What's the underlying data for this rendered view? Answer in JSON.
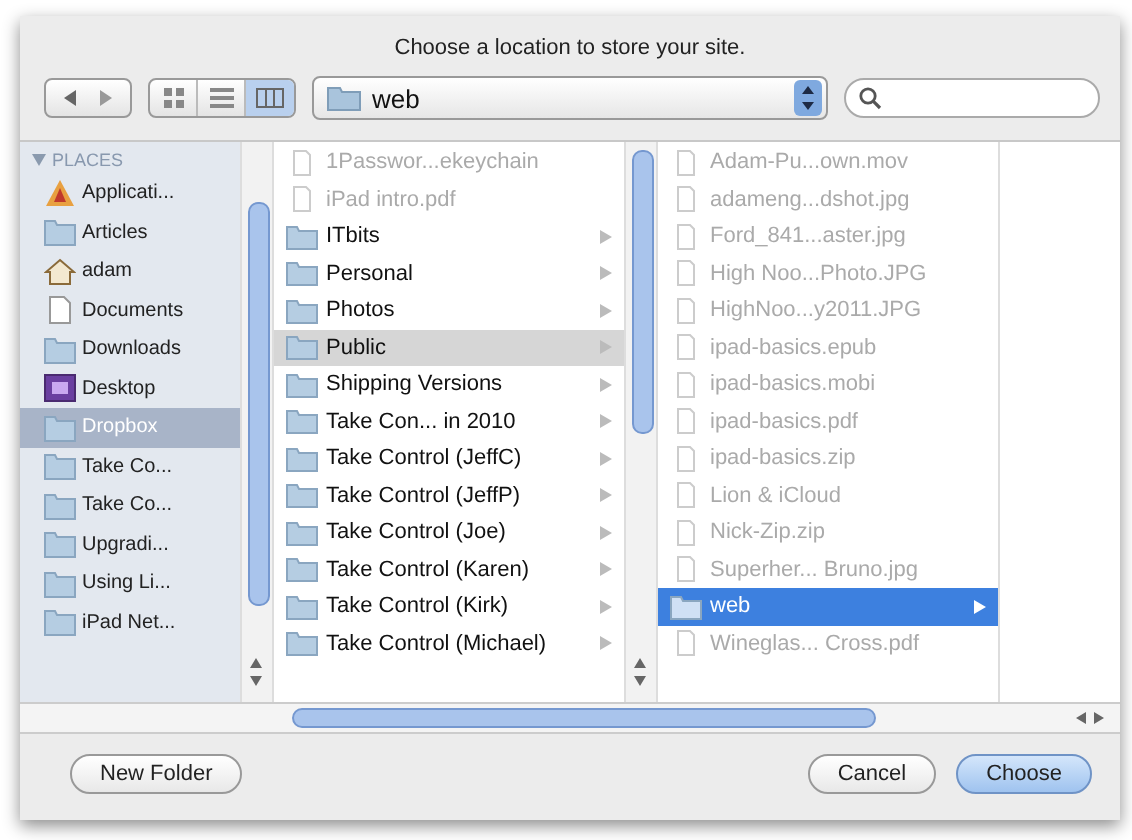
{
  "message": "Choose a location to store your site.",
  "toolbar": {
    "view_modes": [
      {
        "kind": "icon",
        "selected": false
      },
      {
        "kind": "list",
        "selected": false
      },
      {
        "kind": "column",
        "selected": true
      }
    ],
    "location": "web"
  },
  "sidebar": {
    "heading": "PLACES",
    "expanded": true,
    "items": [
      {
        "label": "Applicati...",
        "kind": "app",
        "selected": false
      },
      {
        "label": "Articles",
        "kind": "folder",
        "selected": false
      },
      {
        "label": "adam",
        "kind": "home",
        "selected": false
      },
      {
        "label": "Documents",
        "kind": "document",
        "selected": false
      },
      {
        "label": "Downloads",
        "kind": "folder",
        "selected": false
      },
      {
        "label": "Desktop",
        "kind": "desktop",
        "selected": false
      },
      {
        "label": "Dropbox",
        "kind": "folder",
        "selected": true
      },
      {
        "label": "Take Co...",
        "kind": "folder",
        "selected": false
      },
      {
        "label": "Take Co...",
        "kind": "folder",
        "selected": false
      },
      {
        "label": "Upgradi...",
        "kind": "folder",
        "selected": false
      },
      {
        "label": "Using Li...",
        "kind": "folder",
        "selected": false
      },
      {
        "label": "iPad Net...",
        "kind": "folder",
        "selected": false
      }
    ]
  },
  "columns": [
    {
      "focused": false,
      "items": [
        {
          "name": "1Passwor...ekeychain",
          "kind": "file",
          "disabled": true,
          "selected": false
        },
        {
          "name": "iPad intro.pdf",
          "kind": "file",
          "disabled": true,
          "selected": false
        },
        {
          "name": "ITbits",
          "kind": "folder",
          "disabled": false,
          "selected": false
        },
        {
          "name": "Personal",
          "kind": "folder",
          "disabled": false,
          "selected": false
        },
        {
          "name": "Photos",
          "kind": "folder",
          "disabled": false,
          "selected": false
        },
        {
          "name": "Public",
          "kind": "folder",
          "disabled": false,
          "selected": true
        },
        {
          "name": "Shipping Versions",
          "kind": "folder",
          "disabled": false,
          "selected": false
        },
        {
          "name": "Take Con... in 2010",
          "kind": "folder",
          "disabled": false,
          "selected": false
        },
        {
          "name": "Take Control (JeffC)",
          "kind": "folder",
          "disabled": false,
          "selected": false
        },
        {
          "name": "Take Control (JeffP)",
          "kind": "folder",
          "disabled": false,
          "selected": false
        },
        {
          "name": "Take Control (Joe)",
          "kind": "folder",
          "disabled": false,
          "selected": false
        },
        {
          "name": "Take Control (Karen)",
          "kind": "folder",
          "disabled": false,
          "selected": false
        },
        {
          "name": "Take Control (Kirk)",
          "kind": "folder",
          "disabled": false,
          "selected": false
        },
        {
          "name": "Take Control (Michael)",
          "kind": "folder",
          "disabled": false,
          "selected": false
        }
      ]
    },
    {
      "focused": true,
      "items": [
        {
          "name": "Adam-Pu...own.mov",
          "kind": "file",
          "disabled": true,
          "selected": false
        },
        {
          "name": "adameng...dshot.jpg",
          "kind": "file",
          "disabled": true,
          "selected": false
        },
        {
          "name": "Ford_841...aster.jpg",
          "kind": "file",
          "disabled": true,
          "selected": false
        },
        {
          "name": "High Noo...Photo.JPG",
          "kind": "file",
          "disabled": true,
          "selected": false
        },
        {
          "name": "HighNoo...y2011.JPG",
          "kind": "file",
          "disabled": true,
          "selected": false
        },
        {
          "name": "ipad-basics.epub",
          "kind": "file",
          "disabled": true,
          "selected": false
        },
        {
          "name": "ipad-basics.mobi",
          "kind": "file",
          "disabled": true,
          "selected": false
        },
        {
          "name": "ipad-basics.pdf",
          "kind": "file",
          "disabled": true,
          "selected": false
        },
        {
          "name": "ipad-basics.zip",
          "kind": "file",
          "disabled": true,
          "selected": false
        },
        {
          "name": "Lion & iCloud",
          "kind": "file",
          "disabled": true,
          "selected": false
        },
        {
          "name": "Nick-Zip.zip",
          "kind": "file",
          "disabled": true,
          "selected": false
        },
        {
          "name": "Superher... Bruno.jpg",
          "kind": "file",
          "disabled": true,
          "selected": false
        },
        {
          "name": "web",
          "kind": "folder",
          "disabled": false,
          "selected": true
        },
        {
          "name": "Wineglas... Cross.pdf",
          "kind": "file",
          "disabled": true,
          "selected": false
        }
      ]
    }
  ],
  "buttons": [
    {
      "label": "New Folder",
      "default": false
    },
    {
      "label": "Cancel",
      "default": false
    },
    {
      "label": "Choose",
      "default": true
    }
  ]
}
